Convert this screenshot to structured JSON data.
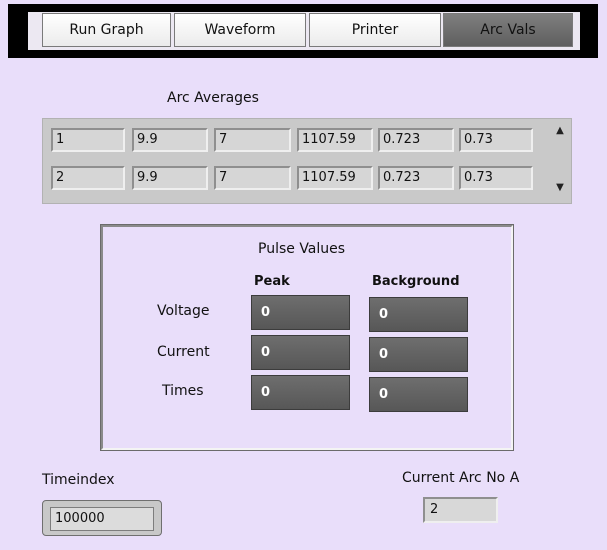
{
  "tabs": [
    {
      "label": "Run Graph",
      "active": false
    },
    {
      "label": "Waveform",
      "active": false
    },
    {
      "label": "Printer",
      "active": false
    },
    {
      "label": "Arc Vals",
      "active": true
    }
  ],
  "arc_averages": {
    "title": "Arc Averages",
    "rows": [
      [
        "1",
        "9.9",
        "7",
        "1107.59",
        "0.723",
        "0.73"
      ],
      [
        "2",
        "9.9",
        "7",
        "1107.59",
        "0.723",
        "0.73"
      ]
    ],
    "scroll_up_icon": "arrow-up-icon",
    "scroll_down_icon": "arrow-down-icon"
  },
  "pulse_values": {
    "title": "Pulse Values",
    "col_peak": "Peak",
    "col_background": "Background",
    "rows": [
      {
        "label": "Voltage",
        "peak": "0",
        "background": "0"
      },
      {
        "label": "Current",
        "peak": "0",
        "background": "0"
      },
      {
        "label": "Times",
        "peak": "0",
        "background": "0"
      }
    ]
  },
  "timeindex": {
    "label": "Timeindex",
    "value": "100000"
  },
  "current_arc": {
    "label": "Current Arc No A",
    "value": "2"
  },
  "colors": {
    "panel_background": "#e9defa",
    "active_tab": "#6f6f6f",
    "dark_field": "#626262"
  }
}
